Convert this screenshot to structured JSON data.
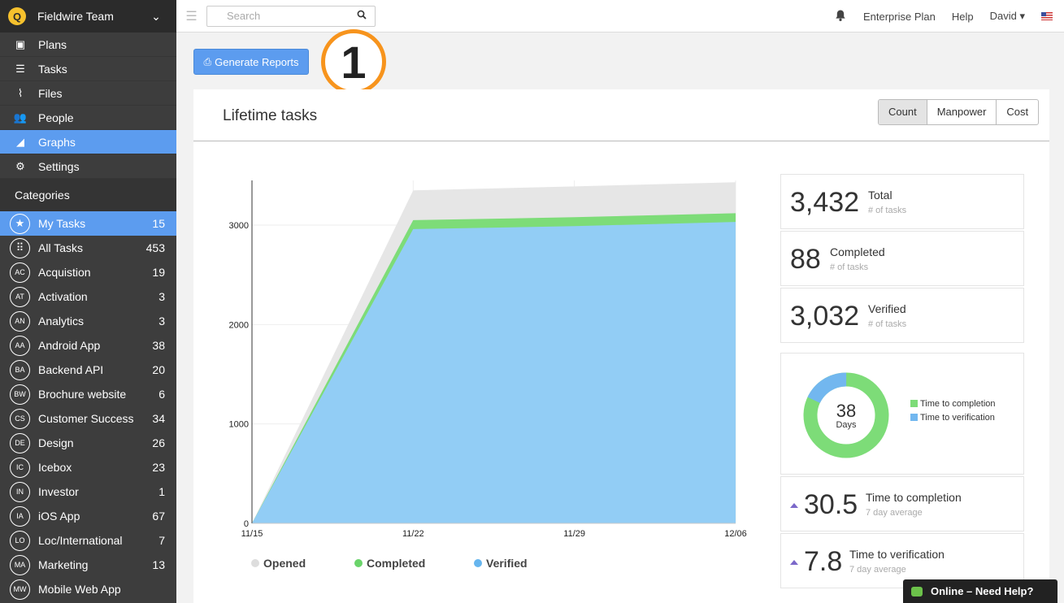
{
  "team": {
    "name": "Fieldwire Team",
    "logo": "Q"
  },
  "nav": [
    {
      "label": "Plans",
      "icon": "plans-icon",
      "glyph": "▣"
    },
    {
      "label": "Tasks",
      "icon": "list-icon",
      "glyph": "☰"
    },
    {
      "label": "Files",
      "icon": "paperclip-icon",
      "glyph": "⌇"
    },
    {
      "label": "People",
      "icon": "people-icon",
      "glyph": "👥"
    },
    {
      "label": "Graphs",
      "icon": "area-chart-icon",
      "glyph": "◢",
      "active": true
    },
    {
      "label": "Settings",
      "icon": "gear-icon",
      "glyph": "⚙"
    }
  ],
  "categories_heading": "Categories",
  "categories": [
    {
      "badge": "★",
      "label": "My Tasks",
      "count": "15",
      "active": true
    },
    {
      "badge": "⠿",
      "label": "All Tasks",
      "count": "453"
    },
    {
      "badge": "AC",
      "label": "Acquistion",
      "count": "19"
    },
    {
      "badge": "AT",
      "label": "Activation",
      "count": "3"
    },
    {
      "badge": "AN",
      "label": "Analytics",
      "count": "3"
    },
    {
      "badge": "AA",
      "label": "Android App",
      "count": "38"
    },
    {
      "badge": "BA",
      "label": "Backend API",
      "count": "20"
    },
    {
      "badge": "BW",
      "label": "Brochure website",
      "count": "6"
    },
    {
      "badge": "CS",
      "label": "Customer Success",
      "count": "34"
    },
    {
      "badge": "DE",
      "label": "Design",
      "count": "26"
    },
    {
      "badge": "IC",
      "label": "Icebox",
      "count": "23"
    },
    {
      "badge": "IN",
      "label": "Investor",
      "count": "1"
    },
    {
      "badge": "IA",
      "label": "iOS App",
      "count": "67"
    },
    {
      "badge": "LO",
      "label": "Loc/International",
      "count": "7"
    },
    {
      "badge": "MA",
      "label": "Marketing",
      "count": "13"
    },
    {
      "badge": "MW",
      "label": "Mobile Web App",
      "count": ""
    }
  ],
  "topbar": {
    "search_placeholder": "Search",
    "plan": "Enterprise Plan",
    "help": "Help",
    "user": "David ▾"
  },
  "main": {
    "generate_reports": "Generate Reports",
    "callout": "1",
    "panel_title": "Lifetime tasks",
    "segments": [
      "Count",
      "Manpower",
      "Cost"
    ],
    "active_segment": "Count"
  },
  "stats": {
    "total": {
      "value": "3,432",
      "label": "Total",
      "sub": "# of tasks"
    },
    "completed": {
      "value": "88",
      "label": "Completed",
      "sub": "# of tasks"
    },
    "verified": {
      "value": "3,032",
      "label": "Verified",
      "sub": "# of tasks"
    },
    "donut": {
      "value": "38",
      "unit": "Days",
      "legend": [
        "Time to completion",
        "Time to verification"
      ],
      "completion_fraction": 0.82
    },
    "ttc": {
      "value": "30.5",
      "label": "Time to completion",
      "sub": "7 day average"
    },
    "ttv": {
      "value": "7.8",
      "label": "Time to verification",
      "sub": "7 day average"
    }
  },
  "help_widget": "Online – Need Help?",
  "colors": {
    "opened": "#e6e6e6",
    "completed": "#7ddc78",
    "verified": "#92cdf5",
    "accent": "#5c9cef",
    "callout": "#f7941d"
  },
  "chart_data": {
    "type": "area",
    "x": [
      "11/15",
      "11/22",
      "11/29",
      "12/06"
    ],
    "series": [
      {
        "name": "Opened",
        "values": [
          0,
          3350,
          3390,
          3432
        ]
      },
      {
        "name": "Completed",
        "values": [
          0,
          3050,
          3080,
          3120
        ]
      },
      {
        "name": "Verified",
        "values": [
          0,
          2960,
          2990,
          3032
        ]
      }
    ],
    "yticks": [
      0,
      1000,
      2000,
      3000
    ],
    "ylim": [
      0,
      3450
    ],
    "legend": "bottom"
  }
}
